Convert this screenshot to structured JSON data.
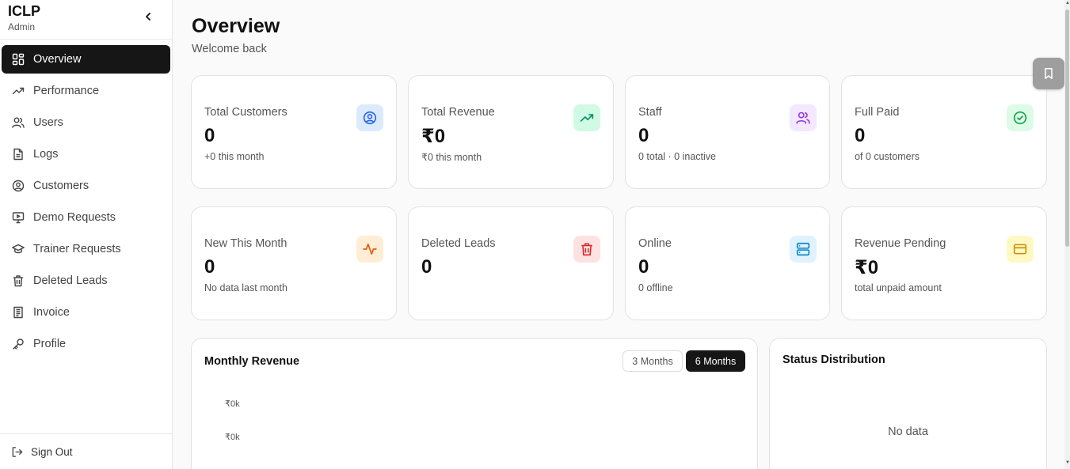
{
  "brand": {
    "title": "ICLP",
    "subtitle": "Admin"
  },
  "sidebar": {
    "items": [
      {
        "label": "Overview",
        "icon": "grid-icon",
        "active": true
      },
      {
        "label": "Performance",
        "icon": "trending-up-icon"
      },
      {
        "label": "Users",
        "icon": "users-icon"
      },
      {
        "label": "Logs",
        "icon": "file-text-icon"
      },
      {
        "label": "Customers",
        "icon": "user-circle-icon"
      },
      {
        "label": "Demo Requests",
        "icon": "monitor-play-icon"
      },
      {
        "label": "Trainer Requests",
        "icon": "graduation-cap-icon"
      },
      {
        "label": "Deleted Leads",
        "icon": "trash-icon"
      },
      {
        "label": "Invoice",
        "icon": "receipt-icon"
      },
      {
        "label": "Profile",
        "icon": "key-icon"
      }
    ],
    "signout": "Sign Out"
  },
  "header": {
    "title": "Overview",
    "subtitle": "Welcome back"
  },
  "stats": [
    {
      "label": "Total Customers",
      "value": "0",
      "sub": "+0 this month",
      "icon": "user-circle-icon",
      "color": "#2563eb",
      "bg": "#dbeafe"
    },
    {
      "label": "Total Revenue",
      "value": "₹0",
      "sub": "₹0 this month",
      "icon": "trending-up-icon",
      "color": "#059669",
      "bg": "#d1fae5"
    },
    {
      "label": "Staff",
      "value": "0",
      "sub": "0 total · 0 inactive",
      "icon": "users-icon",
      "color": "#9333ea",
      "bg": "#f3e8ff"
    },
    {
      "label": "Full Paid",
      "value": "0",
      "sub": "of 0 customers",
      "icon": "check-circle-icon",
      "color": "#16a34a",
      "bg": "#dcfce7"
    },
    {
      "label": "New This Month",
      "value": "0",
      "sub": "No data last month",
      "icon": "activity-icon",
      "color": "#ea580c",
      "bg": "#ffedd5"
    },
    {
      "label": "Deleted Leads",
      "value": "0",
      "sub": "",
      "icon": "trash-icon",
      "color": "#dc2626",
      "bg": "#fee2e2"
    },
    {
      "label": "Online",
      "value": "0",
      "sub": "0 offline",
      "icon": "server-icon",
      "color": "#0284c7",
      "bg": "#e0f2fe"
    },
    {
      "label": "Revenue Pending",
      "value": "₹0",
      "sub": "total unpaid amount",
      "icon": "credit-card-icon",
      "color": "#ca8a04",
      "bg": "#fef9c3"
    }
  ],
  "monthly_revenue": {
    "title": "Monthly Revenue",
    "range_options": [
      "3 Months",
      "6 Months"
    ],
    "selected_range": "6 Months",
    "y_ticks": [
      "₹0k",
      "₹0k"
    ]
  },
  "status_distribution": {
    "title": "Status Distribution",
    "empty_text": "No data"
  }
}
